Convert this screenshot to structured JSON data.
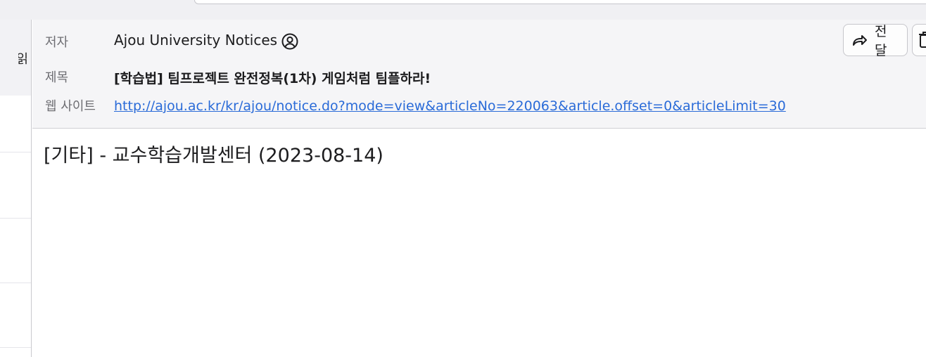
{
  "header": {
    "from_label": "저자",
    "from_value": "Ajou University Notices",
    "subject_label": "제목",
    "subject_value": "[학습법] 팀프로젝트 완전정복(1차) 게임처럼 팀플하라!",
    "website_label": "웹 사이트",
    "website_value": "http://ajou.ac.kr/kr/ajou/notice.do?mode=view&articleNo=220063&article.offset=0&articleLimit=30"
  },
  "toolbar": {
    "forward_label": "전달",
    "forward_icon": "forward-arrow-icon",
    "extra_icon": "trash-icon"
  },
  "left_pane": {
    "partial_label": "읽"
  },
  "message": {
    "body_text": "[기타] - 교수학습개발센터 (2023-08-14)"
  },
  "colors": {
    "link": "#2a6bd8",
    "header_bg": "#f5f5f7",
    "label": "#6e6e73"
  }
}
